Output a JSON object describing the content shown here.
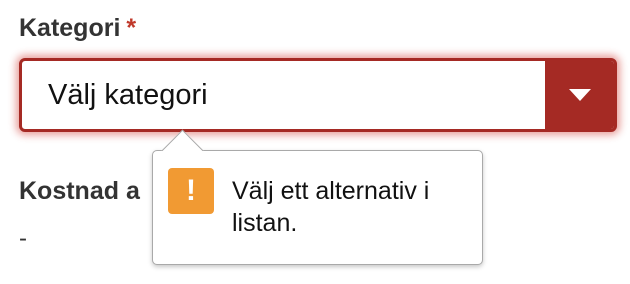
{
  "form": {
    "category_label": "Kategori",
    "required_marker": "*",
    "category_select": {
      "selected_value": "Välj kategori"
    },
    "cost_label": "Kostnad a",
    "cost_value": "-"
  },
  "validation_tooltip": {
    "icon": "exclamation-warning-icon",
    "icon_glyph": "!",
    "message": "Välj ett alternativ i listan."
  },
  "colors": {
    "select_accent": "#a52a24",
    "warning_icon": "#f19a33",
    "required_marker": "#c0392b"
  }
}
